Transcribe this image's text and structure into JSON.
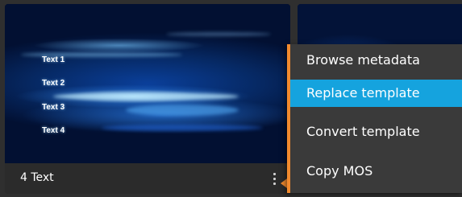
{
  "template_card": {
    "title": "4 Text",
    "preview_lines": [
      "Text 1",
      "Text 2",
      "Text 3",
      "Text 4"
    ]
  },
  "context_menu": {
    "items": [
      {
        "label": "Browse metadata",
        "selected": false
      },
      {
        "label": "Replace template",
        "selected": true
      },
      {
        "label": "Convert template",
        "selected": false
      },
      {
        "label": "Copy MOS",
        "selected": false
      }
    ],
    "highlight_color": "#15a3de",
    "accent_color": "#f28a2e"
  },
  "icons": {
    "card_menu": "kebab-vertical-icon"
  }
}
